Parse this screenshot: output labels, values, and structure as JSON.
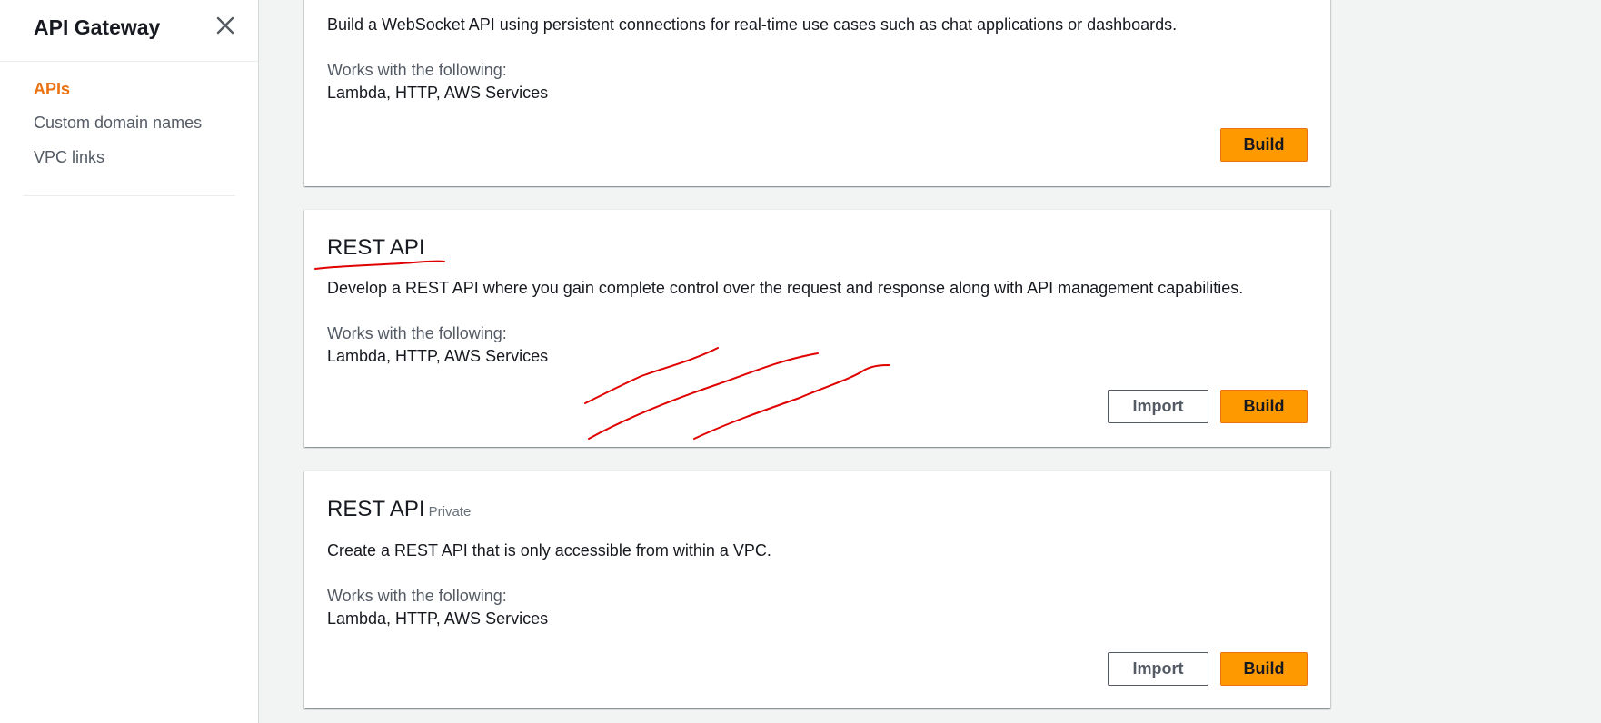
{
  "sidebar": {
    "title": "API Gateway",
    "items": [
      {
        "label": "APIs",
        "active": true
      },
      {
        "label": "Custom domain names",
        "active": false
      },
      {
        "label": "VPC links",
        "active": false
      }
    ]
  },
  "cards": [
    {
      "title": "",
      "description": "Build a WebSocket API using persistent connections for real-time use cases such as chat applications or dashboards.",
      "works_label": "Works with the following:",
      "works_value": "Lambda, HTTP, AWS Services",
      "build_label": "Build"
    },
    {
      "title": "REST API",
      "description": "Develop a REST API where you gain complete control over the request and response along with API management capabilities.",
      "works_label": "Works with the following:",
      "works_value": "Lambda, HTTP, AWS Services",
      "import_label": "Import",
      "build_label": "Build"
    },
    {
      "title": "REST API",
      "badge": "Private",
      "description": "Create a REST API that is only accessible from within a VPC.",
      "works_label": "Works with the following:",
      "works_value": "Lambda, HTTP, AWS Services",
      "import_label": "Import",
      "build_label": "Build"
    }
  ],
  "colors": {
    "accent_orange": "#ff9900",
    "active_nav": "#ec7211",
    "annotation_red": "#e00000"
  },
  "icons": {
    "close": "close-icon"
  }
}
